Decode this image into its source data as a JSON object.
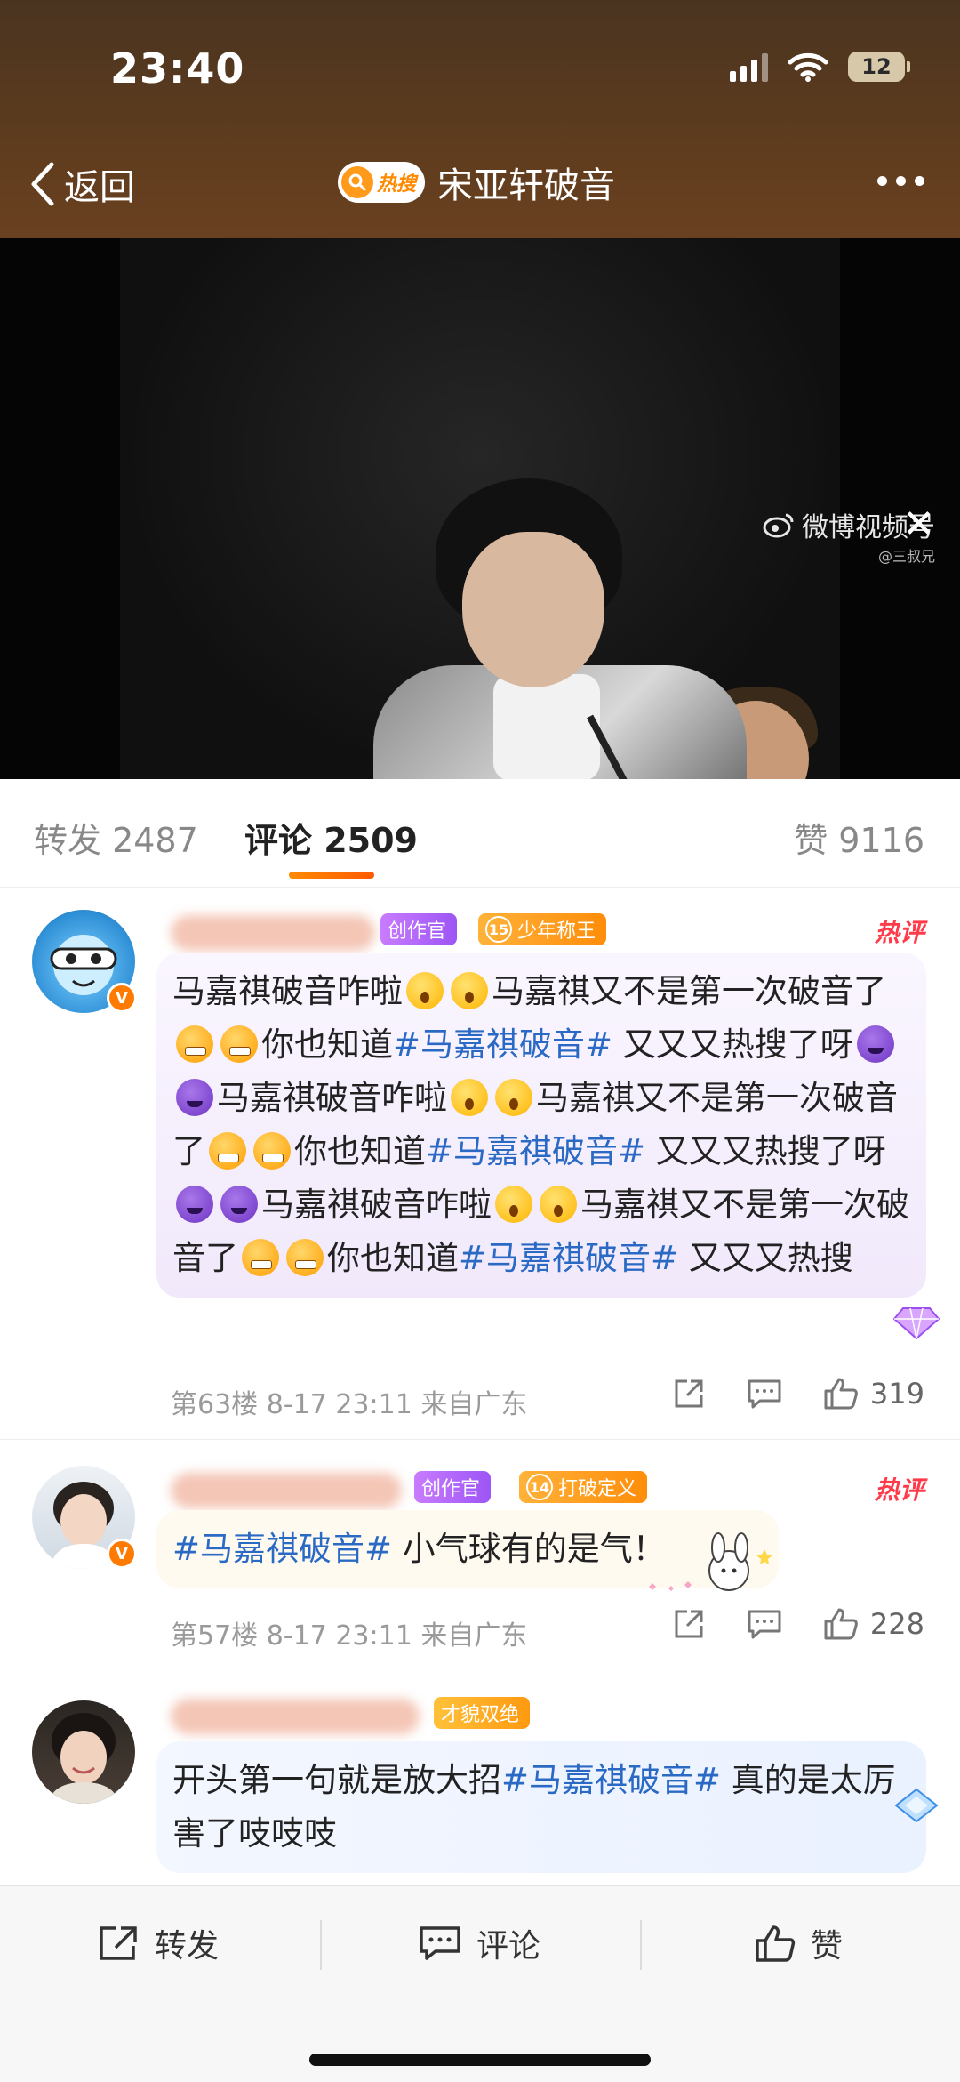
{
  "status_bar": {
    "time": "23:40",
    "battery": "12"
  },
  "nav": {
    "back_label": "返回",
    "hot_badge": "热搜",
    "title": "宋亚轩破音"
  },
  "video": {
    "watermark": "微博视频号",
    "watermark_sub": "@三叔兄"
  },
  "tabs": {
    "repost": "转发 2487",
    "comment": "评论 2509",
    "like": "赞 9116"
  },
  "comments": [
    {
      "tags": [
        "创作官",
        "少年称王"
      ],
      "level": "15",
      "hot_label": "热评",
      "text_segments": [
        "马嘉祺破音咋啦",
        "emo:wow",
        "emo:wow",
        "马嘉祺又不是第一次破音了",
        "emo:angry",
        "emo:angry",
        "你也知道",
        "#马嘉祺破音#",
        " 又又又热搜了呀",
        "emo:devil",
        "emo:devil",
        "马嘉祺破音咋啦",
        "emo:wow",
        "emo:wow",
        "马嘉祺又不是第一次破音了",
        "emo:angry",
        "emo:angry",
        "你也知道",
        "#马嘉祺破音#",
        " 又又又热搜了呀",
        "emo:devil",
        "emo:devil",
        "马嘉祺破音咋啦",
        "emo:wow",
        "emo:wow",
        "马嘉祺又不是第一次破音了",
        "emo:angry",
        "emo:angry",
        "你也知道",
        "#马嘉祺破音#",
        " 又又又热搜"
      ],
      "meta": "第63楼 8-17 23:11 来自广东",
      "likes": "319"
    },
    {
      "tags": [
        "创作官",
        "打破定义"
      ],
      "level": "14",
      "hot_label": "热评",
      "topic": "#马嘉祺破音#",
      "text": " 小气球有的是气！",
      "meta": "第57楼 8-17 23:11 来自广东",
      "likes": "228"
    },
    {
      "tags": [
        "才貌双绝"
      ],
      "text_a": "开头第一句就是放大招",
      "topic": "#马嘉祺破音#",
      "text_b": "  真的是太厉害了吱吱吱"
    }
  ],
  "bottom_bar": {
    "repost": "转发",
    "comment": "评论",
    "like": "赞"
  },
  "colors": {
    "header": "#5e3c1e",
    "topic": "#2a69c4",
    "hot": "#ff3b4a",
    "accent": "#ff8a00"
  }
}
